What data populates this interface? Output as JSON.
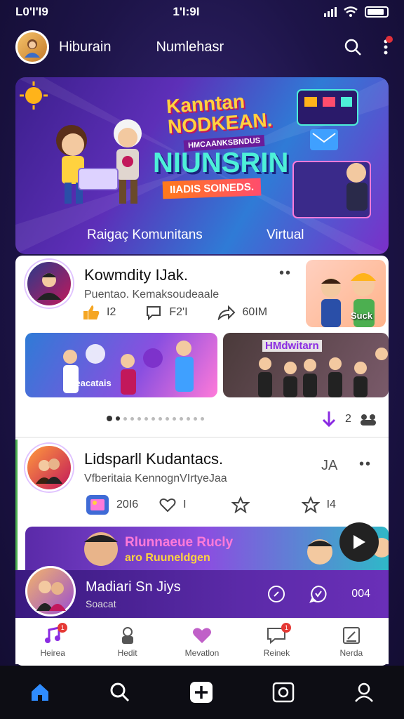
{
  "status": {
    "time_left": "L0'I'I9",
    "time_center": "1'I:9I"
  },
  "topbar": {
    "app_name": "Hiburain",
    "tab_label": "Numlehasr"
  },
  "banner": {
    "title_line1": "Kanntan",
    "title_line2": "NODKEAN.",
    "subtitle_small": "HMCAANKSBNDUS",
    "big_title": "NIUNSRIN",
    "ribbon": "IIADIS SOINEDS.",
    "caption_left": "Raigaç Komunitans",
    "caption_right": "Virtual"
  },
  "post1": {
    "name": "Kowmdity IJak.",
    "desc": "Puentao. Kemaksoudeaale",
    "likes": "I2",
    "comments": "F2'I",
    "shares": "60IM",
    "side_label": "Suck",
    "thumb1_label": "Aeacatais",
    "thumb2_label": "HMdwitarn",
    "reaction_count": "2"
  },
  "post2": {
    "name": "Lidsparll Kudantacs.",
    "desc": "Vfberitaia KennognVIrtyeJaa",
    "count": "20I6",
    "likes": "I",
    "stars": "I4",
    "side_label": "JA",
    "video_title": "Rlunnaeue Rucly",
    "video_sub": "aro Ruuneldgen"
  },
  "mini_player": {
    "title": "Madiari Sn Jiys",
    "subtitle": "Soacat",
    "count": "004"
  },
  "tabs": [
    {
      "label": "Heirea",
      "badge": "1"
    },
    {
      "label": "Hedit",
      "badge": ""
    },
    {
      "label": "Mevatlon",
      "badge": ""
    },
    {
      "label": "Reinek",
      "badge": "1"
    },
    {
      "label": "Nerda",
      "badge": ""
    }
  ],
  "colors": {
    "accent": "#6a2fb8",
    "badge": "#e53935",
    "nav_home": "#2f8cff"
  }
}
